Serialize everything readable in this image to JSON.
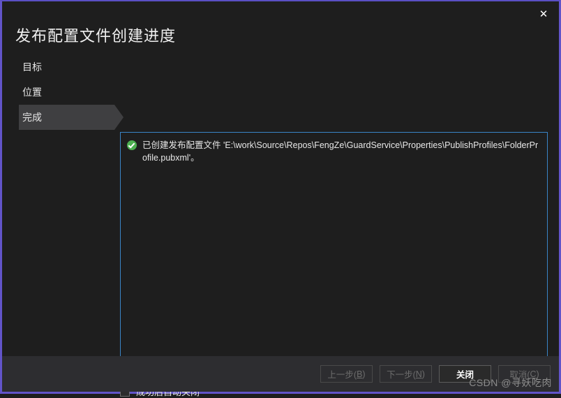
{
  "window": {
    "title": "发布配置文件创建进度",
    "close_icon": "✕",
    "accent_border": "#6254c9",
    "background": "#1e1e1e"
  },
  "sidebar": {
    "items": [
      {
        "label": "目标",
        "selected": false
      },
      {
        "label": "位置",
        "selected": false
      },
      {
        "label": "完成",
        "selected": true
      }
    ]
  },
  "main": {
    "panel_border_color": "#3a86c8",
    "status_icon": "success-check-icon",
    "status_color": "#4caf50",
    "message": "已创建发布配置文件 'E:\\work\\Source\\Repos\\FengZe\\GuardService\\Properties\\PublishProfiles\\FolderProfile.pubxml'。"
  },
  "options": {
    "auto_close_label": "成功后自动关闭",
    "auto_close_checked": false
  },
  "footer": {
    "buttons": [
      {
        "label": "上一步(B)",
        "accel": "B",
        "text_main": "上一步(",
        "text_tail": ")",
        "enabled": false
      },
      {
        "label": "下一步(N)",
        "accel": "N",
        "text_main": "下一步(",
        "text_tail": ")",
        "enabled": false
      },
      {
        "label": "关闭",
        "accel": "",
        "text_main": "关闭",
        "text_tail": "",
        "enabled": true
      },
      {
        "label": "取消(C)",
        "accel": "C",
        "text_main": "取消(",
        "text_tail": ")",
        "enabled": false
      }
    ]
  },
  "watermark": {
    "text": "CSDN @寻妖吃肉"
  }
}
